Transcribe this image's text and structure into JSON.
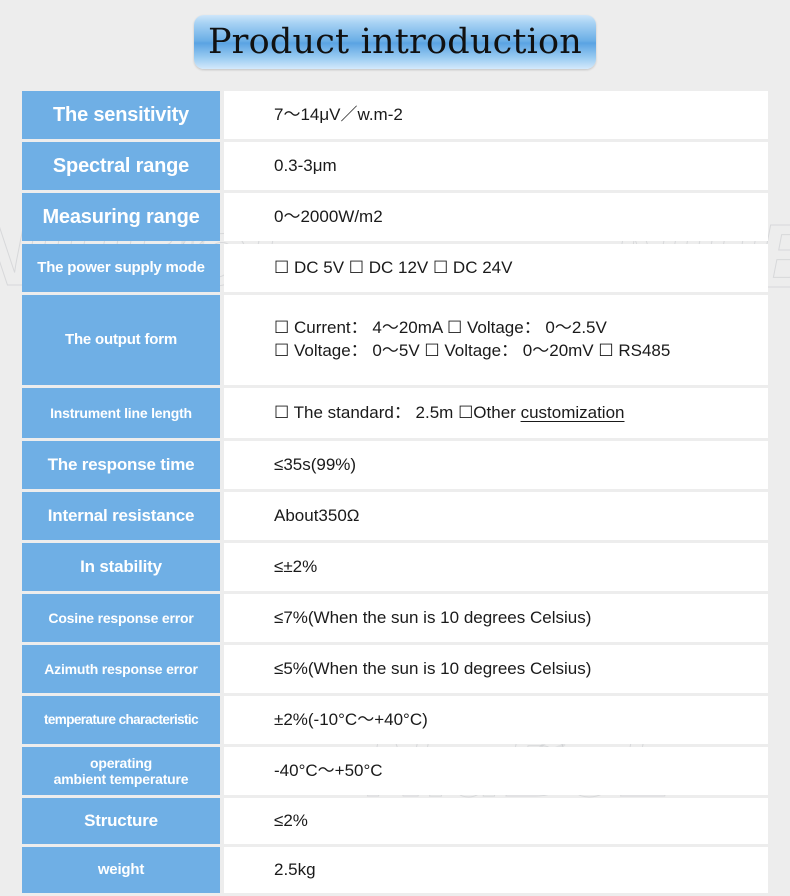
{
  "title": "Product introduction",
  "watermark": {
    "text_left": "NiuBoL",
    "text_right": "NiuB",
    "text_bottom": "NiuBoL",
    "icon": "wifi-signal-icon"
  },
  "colors": {
    "label_blue": "#6FAFE5",
    "page_background": "#EDEDED",
    "value_background": "#FFFFFF",
    "title_text": "#111111",
    "label_text": "#FFFFFF"
  },
  "table": {
    "rows": [
      {
        "label": "The sensitivity",
        "value_lines": [
          "7～14μV／w.m-2"
        ]
      },
      {
        "label": "Spectral range",
        "value_lines": [
          "0.3-3μm"
        ]
      },
      {
        "label": "Measuring range",
        "value_lines": [
          "0～2000W/m2"
        ]
      },
      {
        "label": "The power supply mode",
        "value_lines": [
          "☐ DC 5V  ☐ DC 12V  ☐ DC 24V"
        ]
      },
      {
        "label": "The output form",
        "value_lines": [
          "☐ Current：  4～20mA ☐ Voltage：  0～2.5V",
          "☐ Voltage：  0～5V ☐ Voltage：  0～20mV ☐ RS485"
        ]
      },
      {
        "label": "Instrument line length",
        "value_lines": [
          "☐ The standard：  2.5m ☐Other "
        ],
        "value_underlined": "customization "
      },
      {
        "label": "The response time",
        "value_lines": [
          "≤35s(99%)"
        ]
      },
      {
        "label": "Internal resistance",
        "value_lines": [
          "About350Ω"
        ]
      },
      {
        "label": "In stability",
        "value_lines": [
          "≤±2%"
        ]
      },
      {
        "label": "Cosine response error",
        "value_lines": [
          "≤7%(When the sun is 10 degrees Celsius)"
        ]
      },
      {
        "label": "Azimuth response error",
        "value_lines": [
          "≤5%(When the sun is 10 degrees Celsius)"
        ]
      },
      {
        "label": "temperature characteristic",
        "value_lines": [
          "±2%(-10°C～+40°C)"
        ]
      },
      {
        "label": "operating\nambient temperature",
        "value_lines": [
          "-40°C～+50°C"
        ]
      },
      {
        "label": "Structure",
        "value_lines": [
          "≤2%"
        ]
      },
      {
        "label": "weight",
        "value_lines": [
          "2.5kg"
        ]
      }
    ]
  }
}
